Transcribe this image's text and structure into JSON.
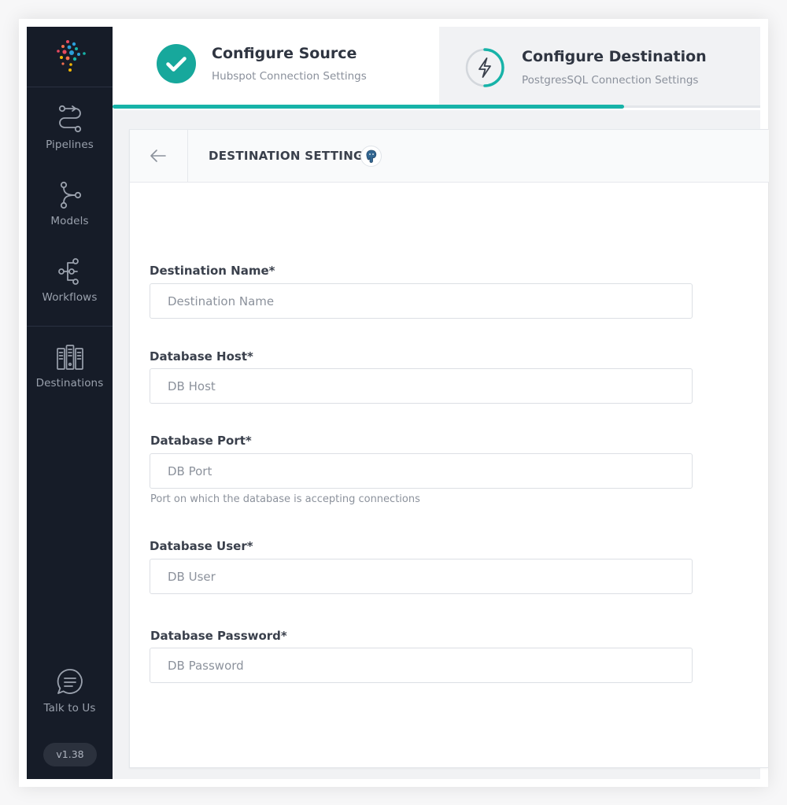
{
  "sidebar": {
    "items": [
      {
        "label": "Pipelines",
        "icon": "pipelines-icon"
      },
      {
        "label": "Models",
        "icon": "models-icon"
      },
      {
        "label": "Workflows",
        "icon": "workflows-icon"
      },
      {
        "label": "Destinations",
        "icon": "destinations-icon"
      }
    ],
    "talk_label": "Talk to Us",
    "version": "v1.38"
  },
  "steps": [
    {
      "title": "Configure Source",
      "subtitle": "Hubspot Connection Settings",
      "status": "complete"
    },
    {
      "title": "Configure Destination",
      "subtitle": "PostgresSQL Connection Settings",
      "status": "active"
    }
  ],
  "progress_percent": 79,
  "card": {
    "title": "DESTINATION SETTINGS",
    "icon": "postgresql-icon"
  },
  "form": {
    "fields": [
      {
        "label": "Destination Name*",
        "placeholder": "Destination Name",
        "value": ""
      },
      {
        "label": "Database Host*",
        "placeholder": "DB Host",
        "value": ""
      },
      {
        "label": "Database Port*",
        "placeholder": "DB Port",
        "value": "",
        "help": "Port on which the database is accepting connections"
      },
      {
        "label": "Database User*",
        "placeholder": "DB User",
        "value": ""
      },
      {
        "label": "Database Password*",
        "placeholder": "DB Password",
        "value": ""
      }
    ]
  },
  "colors": {
    "sidebar_bg": "#161c28",
    "accent": "#17b3a8",
    "step_active_bg": "#f1f2f4"
  }
}
